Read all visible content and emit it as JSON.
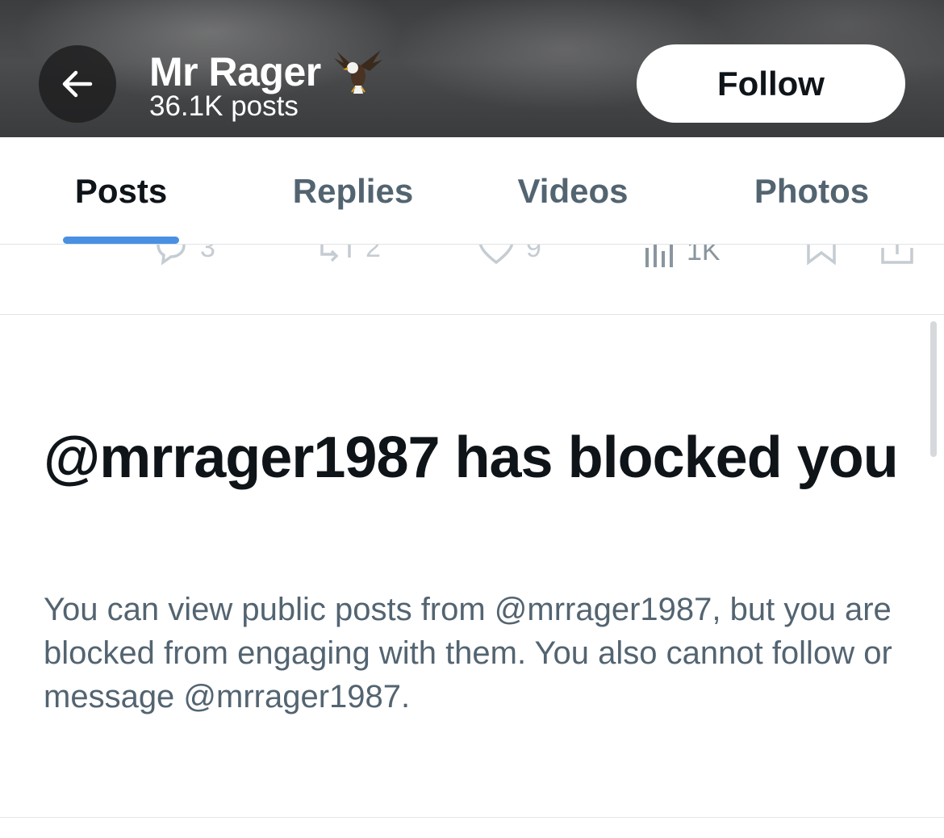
{
  "header": {
    "name": "Mr Rager",
    "post_count": "36.1K posts",
    "follow_label": "Follow",
    "name_icon": "eagle-icon"
  },
  "tabs": [
    {
      "label": "Posts",
      "active": true
    },
    {
      "label": "Replies",
      "active": false
    },
    {
      "label": "Videos",
      "active": false
    },
    {
      "label": "Photos",
      "active": false
    }
  ],
  "action_bar": {
    "reply_count": "3",
    "repost_count": "2",
    "like_count": "9",
    "view_count": "1K"
  },
  "blocked": {
    "title": "@mrrager1987 has blocked you",
    "description": "You can view public posts from @mrrager1987, but you are blocked from engaging with them. You also cannot follow or message @mrrager1987."
  },
  "colors": {
    "accent": "#4a90e2",
    "text_primary": "#0f1419",
    "text_secondary": "#536471"
  }
}
